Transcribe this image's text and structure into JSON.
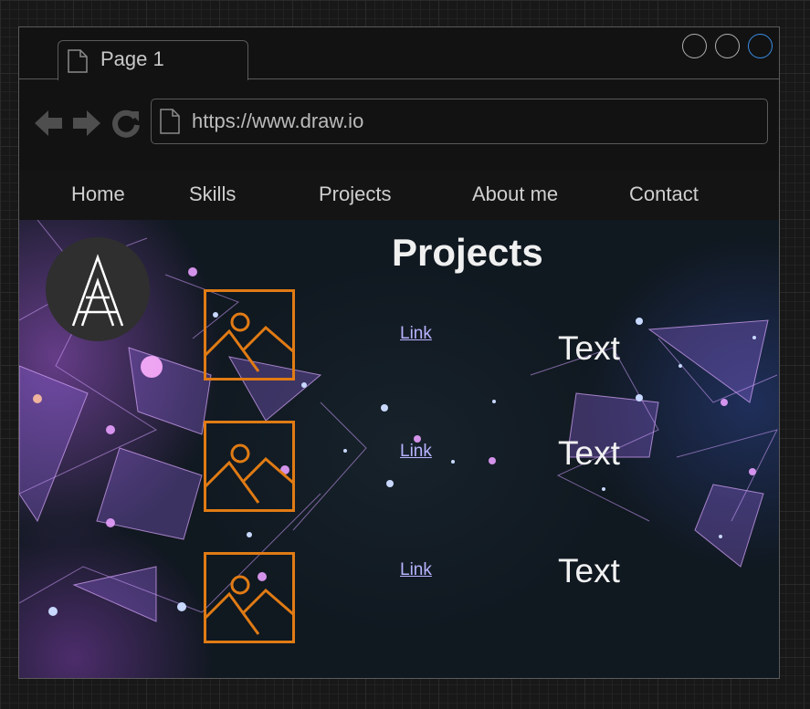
{
  "browser": {
    "tab": {
      "label": "Page 1"
    },
    "address_bar": {
      "url": "https://www.draw.io"
    },
    "icons": {
      "back": "back-arrow-icon",
      "forward": "forward-arrow-icon",
      "reload": "reload-icon",
      "page": "page-icon"
    },
    "colors": {
      "window_button_active": "#3a8ee6",
      "window_button": "#b0b0b0"
    }
  },
  "nav": {
    "items": [
      {
        "label": "Home"
      },
      {
        "label": "Skills"
      },
      {
        "label": "Projects"
      },
      {
        "label": "About me"
      },
      {
        "label": "Contact"
      }
    ]
  },
  "page": {
    "title": "Projects",
    "logo_icon": "monogram-logo",
    "projects": [
      {
        "image_icon": "image-placeholder-icon",
        "link": "Link",
        "text": "Text"
      },
      {
        "image_icon": "image-placeholder-icon",
        "link": "Link",
        "text": "Text"
      },
      {
        "image_icon": "image-placeholder-icon",
        "link": "Link",
        "text": "Text"
      }
    ],
    "colors": {
      "accent": "#e07b14",
      "link": "#b9b3ff",
      "heading": "#f0f0f0"
    }
  }
}
